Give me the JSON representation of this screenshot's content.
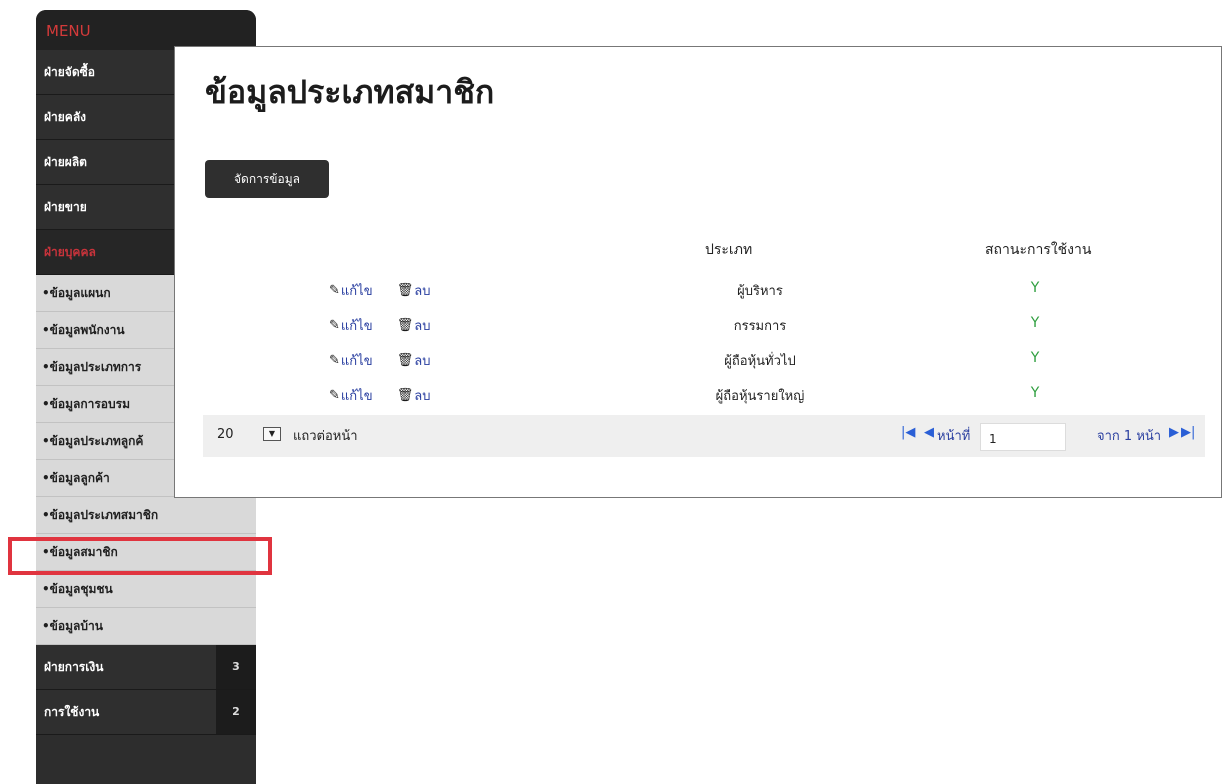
{
  "sidebar": {
    "menu_title": "MENU",
    "sections_top": [
      {
        "label": "ฝ่ายจัดซื้อ"
      },
      {
        "label": "ฝ่ายคลัง"
      },
      {
        "label": "ฝ่ายผลิต"
      },
      {
        "label": "ฝ่ายขาย"
      },
      {
        "label": "ฝ่ายบุคคล"
      }
    ],
    "sub_items": [
      {
        "label": "•ข้อมูลแผนก"
      },
      {
        "label": "•ข้อมูลพนักงาน"
      },
      {
        "label": "•ข้อมูลประเภทการ"
      },
      {
        "label": "•ข้อมูลการอบรม"
      },
      {
        "label": "•ข้อมูลประเภทลูกค้"
      },
      {
        "label": "•ข้อมูลลูกค้า"
      },
      {
        "label": "•ข้อมูลประเภทสมาชิก"
      },
      {
        "label": "•ข้อมูลสมาชิก"
      },
      {
        "label": "•ข้อมูลชุมชน"
      },
      {
        "label": "•ข้อมูลบ้าน"
      }
    ],
    "sections_bottom": [
      {
        "label": "ฝ่ายการเงิน",
        "badge": "3"
      },
      {
        "label": "การใช้งาน",
        "badge": "2"
      }
    ]
  },
  "main": {
    "title": "ข้อมูลประเภทสมาชิก",
    "manage_button": "จัดการข้อมูล",
    "columns": {
      "type": "ประเภท",
      "status": "สถานะการใช้งาน"
    },
    "edit_label": "แก้ไข",
    "delete_label": "ลบ",
    "rows": [
      {
        "type": "ผู้บริหาร",
        "status": "Y"
      },
      {
        "type": "กรรมการ",
        "status": "Y"
      },
      {
        "type": "ผู้ถือหุ้นทั่วไป",
        "status": "Y"
      },
      {
        "type": "ผู้ถือหุ้นรายใหญ่",
        "status": "Y"
      }
    ]
  },
  "pager": {
    "page_size": "20",
    "per_page_label": "แถวต่อหน้า",
    "page_label": "หน้าที่",
    "current_page": "1",
    "of_label": "จาก 1 หน้า"
  },
  "colors": {
    "sidebar_bg": "#2d2d2d",
    "active_section": "#c8333b",
    "highlight_box": "#e0343f",
    "status_green": "#2e9e3e",
    "link_blue": "#2a3fa0"
  }
}
